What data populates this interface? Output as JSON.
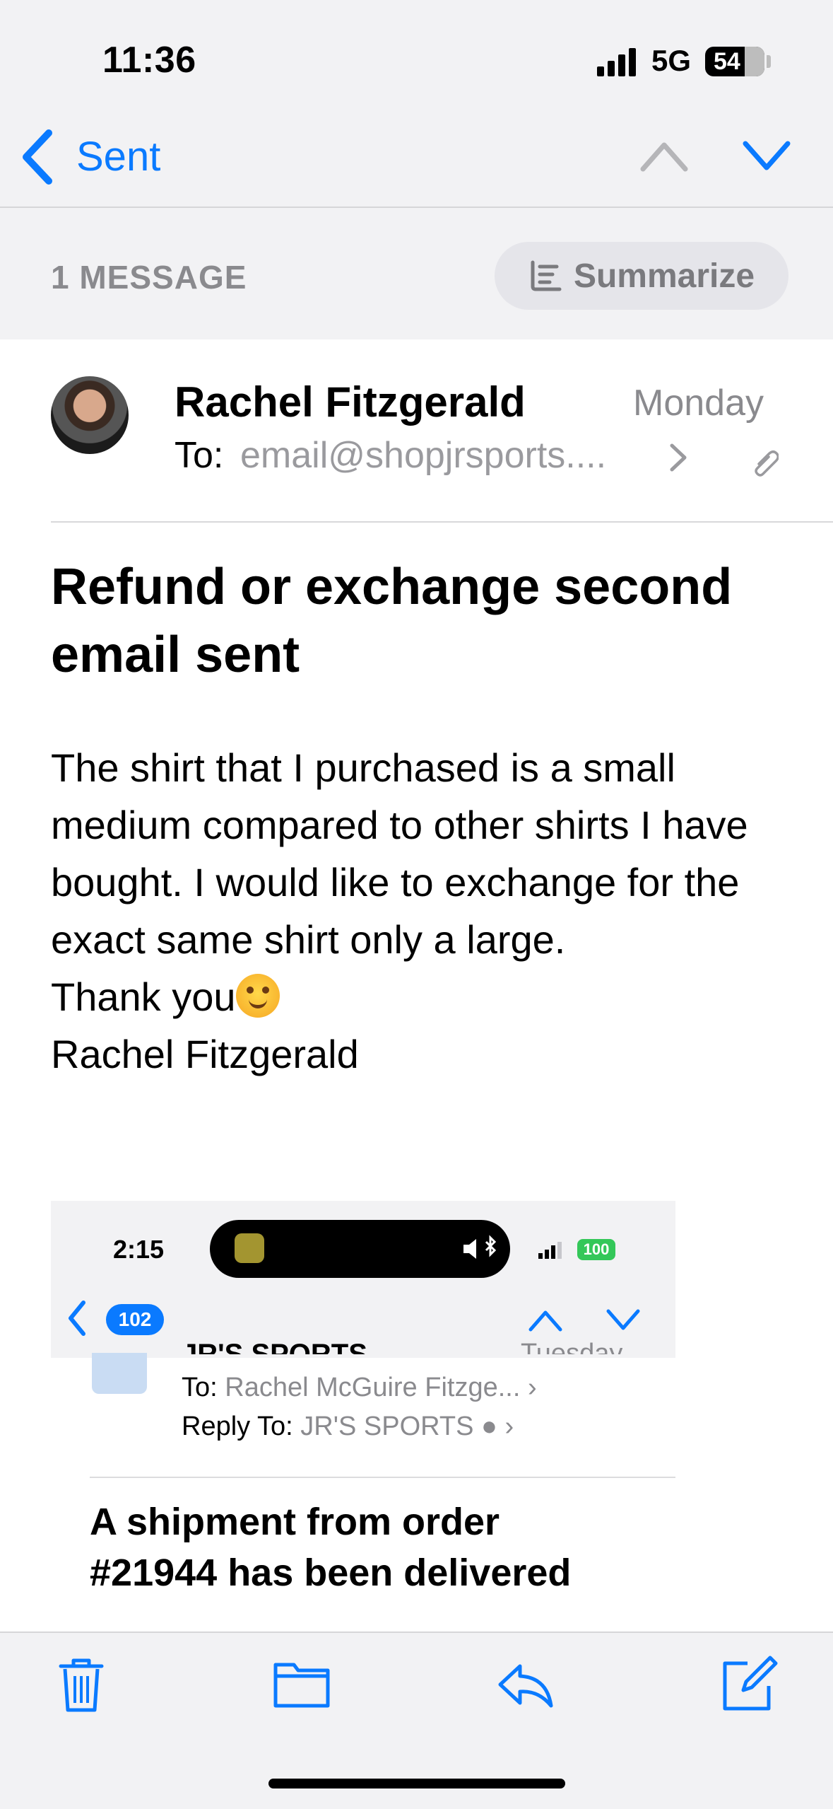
{
  "status_bar": {
    "time": "11:36",
    "network": "5G",
    "battery": "54"
  },
  "nav": {
    "back_label": "Sent"
  },
  "message_count": "1 MESSAGE",
  "summarize_label": "Summarize",
  "email": {
    "sender": "Rachel Fitzgerald",
    "date": "Monday",
    "to_label": "To:",
    "to_value": "email@shopjrsports....",
    "subject": "Refund or exchange second email sent",
    "body_main": "The shirt that I purchased is a small medium compared to other shirts I have bought. I would like to exchange for the exact same shirt only a large.",
    "body_thanks": "Thank you",
    "body_signature": "Rachel Fitzgerald"
  },
  "attachment_screenshot": {
    "time": "2:15",
    "battery": "100",
    "badge_count": "102",
    "sender_cut": "JR'S SPORTS",
    "date_cut": "Tuesday",
    "to_label": "To:",
    "to_value": "Rachel McGuire Fitzge...",
    "reply_label": "Reply To:",
    "reply_value": "JR'S SPORTS",
    "subject": "A shipment from order #21944 has been delivered"
  },
  "toolbar": {
    "icons": [
      "trash-icon",
      "folder-icon",
      "reply-icon",
      "compose-icon"
    ]
  },
  "colors": {
    "accent": "#0a7aff",
    "secondary_text": "#8a8a8e",
    "background": "#f2f2f4"
  }
}
